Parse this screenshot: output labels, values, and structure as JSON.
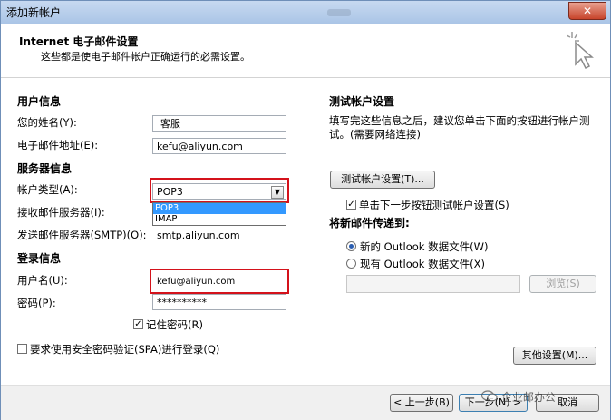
{
  "window": {
    "title": "添加新帐户",
    "close_label": "✕"
  },
  "header": {
    "title": "Internet 电子邮件设置",
    "subtitle": "这些都是使电子邮件帐户正确运行的必需设置。"
  },
  "user_info": {
    "section": "用户信息",
    "name_label": "您的姓名(Y):",
    "name_value": "客服",
    "email_label": "电子邮件地址(E):",
    "email_value": "kefu@aliyun.com"
  },
  "server_info": {
    "section": "服务器信息",
    "type_label": "帐户类型(A):",
    "type_value": "POP3",
    "type_options": [
      "POP3",
      "IMAP"
    ],
    "incoming_label": "接收邮件服务器(I):",
    "outgoing_label": "发送邮件服务器(SMTP)(O):",
    "outgoing_value": "smtp.aliyun.com"
  },
  "login_info": {
    "section": "登录信息",
    "user_label": "用户名(U):",
    "user_value": "kefu@aliyun.com",
    "password_label": "密码(P):",
    "password_value": "**********",
    "remember_label": "记住密码(R)",
    "spa_label": "要求使用安全密码验证(SPA)进行登录(Q)"
  },
  "test_settings": {
    "section": "测试帐户设置",
    "desc": "填写完这些信息之后，建议您单击下面的按钮进行帐户测试。(需要网络连接)",
    "test_button": "测试帐户设置(T)...",
    "auto_test_label": "单击下一步按钮测试帐户设置(S)",
    "deliver_section": "将新邮件传递到:",
    "new_file_label": "新的 Outlook 数据文件(W)",
    "existing_file_label": "现有 Outlook 数据文件(X)",
    "browse_button": "浏览(S)"
  },
  "other_settings_button": "其他设置(M)...",
  "footer": {
    "back_button": "< 上一步(B)",
    "next_button": "下一步(N) >",
    "cancel_button": "取消"
  },
  "watermark": "企业邮办公",
  "colors": {
    "highlight_red": "#d4121b",
    "selection_blue": "#3399ff"
  }
}
